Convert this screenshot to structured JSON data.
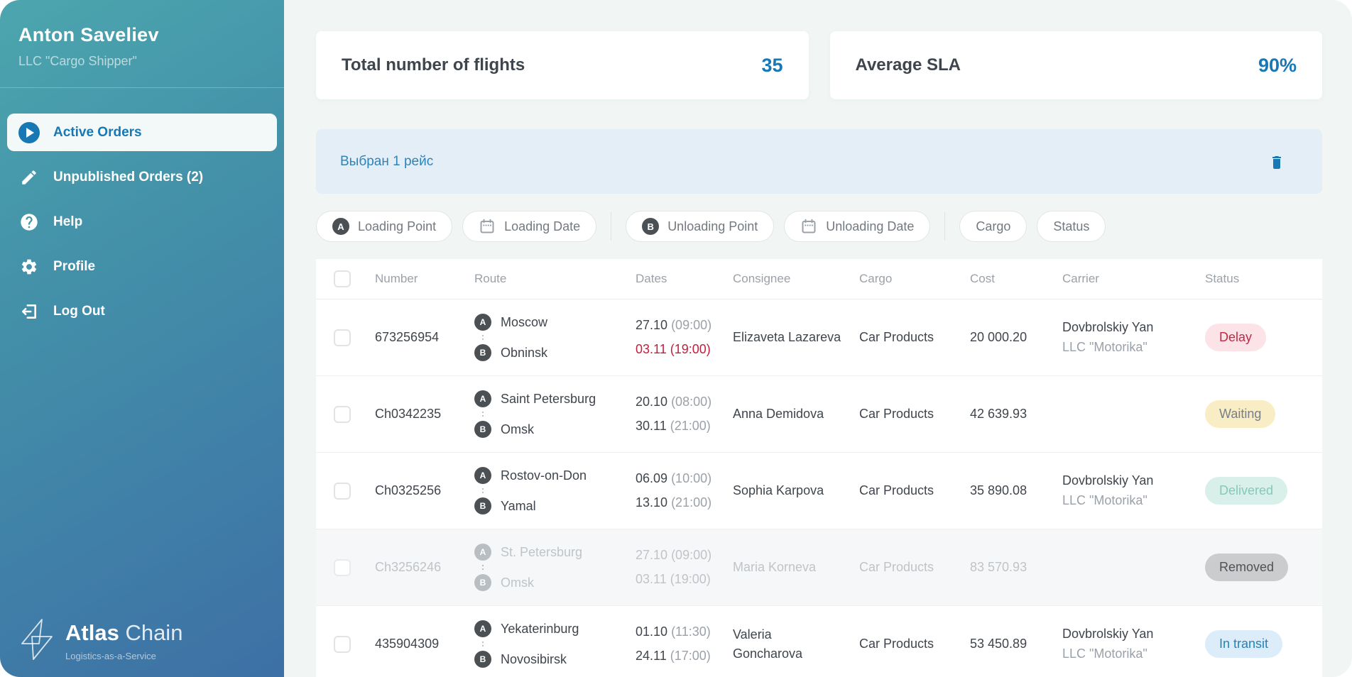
{
  "sidebar": {
    "user_name": "Anton Saveliev",
    "company": "LLC \"Cargo Shipper\"",
    "menu": [
      {
        "label": "Active Orders",
        "icon": "play-circle-icon",
        "active": true
      },
      {
        "label": "Unpublished Orders (2)",
        "icon": "pencil-icon",
        "active": false
      },
      {
        "label": "Help",
        "icon": "question-circle-icon",
        "active": false
      },
      {
        "label": "Profile",
        "icon": "gear-icon",
        "active": false
      },
      {
        "label": "Log Out",
        "icon": "logout-icon",
        "active": false
      }
    ],
    "logo": {
      "brand_strong": "Atlas",
      "brand_light": "Chain",
      "tagline": "Logistics-as-a-Service"
    }
  },
  "stats": {
    "flights_label": "Total number of flights",
    "flights_value": "35",
    "sla_label": "Average SLA",
    "sla_value": "90%"
  },
  "selection": {
    "text": "Выбран 1 рейс"
  },
  "filters": {
    "loading_point": "Loading Point",
    "loading_date": "Loading Date",
    "unloading_point": "Unloading Point",
    "unloading_date": "Unloading Date",
    "cargo": "Cargo",
    "status": "Status"
  },
  "table": {
    "route_badge_a": "A",
    "route_badge_b": "B",
    "headers": {
      "number": "Number",
      "route": "Route",
      "dates": "Dates",
      "consignee": "Consignee",
      "cargo": "Cargo",
      "cost": "Cost",
      "carrier": "Carrier",
      "status": "Status"
    },
    "rows": [
      {
        "number": "673256954",
        "from": "Moscow",
        "to": "Obninsk",
        "date1": "27.10",
        "time1": "(09:00)",
        "date2": "03.11",
        "time2": "(19:00)",
        "date2_alert": true,
        "consignee": "Elizaveta Lazareva",
        "cargo": "Car Products",
        "cost": "20 000.20",
        "carrier_name": "Dovbrolskiy Yan",
        "carrier_company": "LLC \"Motorika\"",
        "status": "Delay",
        "status_type": "delay",
        "removed": false
      },
      {
        "number": "Ch0342235",
        "from": "Saint Petersburg",
        "to": "Omsk",
        "date1": "20.10",
        "time1": "(08:00)",
        "date2": "30.11",
        "time2": "(21:00)",
        "date2_alert": false,
        "consignee": "Anna Demidova",
        "cargo": "Car Products",
        "cost": "42 639.93",
        "carrier_name": "",
        "carrier_company": "",
        "status": "Waiting",
        "status_type": "waiting",
        "removed": false
      },
      {
        "number": "Ch0325256",
        "from": "Rostov-on-Don",
        "to": "Yamal",
        "date1": "06.09",
        "time1": "(10:00)",
        "date2": "13.10",
        "time2": "(21:00)",
        "date2_alert": false,
        "consignee": "Sophia Karpova",
        "cargo": "Car Products",
        "cost": "35 890.08",
        "carrier_name": "Dovbrolskiy Yan",
        "carrier_company": "LLC \"Motorika\"",
        "status": "Delivered",
        "status_type": "delivered",
        "removed": false
      },
      {
        "number": "Ch3256246",
        "from": "St. Petersburg",
        "to": "Omsk",
        "date1": "27.10",
        "time1": "(09:00)",
        "date2": "03.11",
        "time2": "(19:00)",
        "date2_alert": false,
        "consignee": "Maria Korneva",
        "cargo": "Car Products",
        "cost": "83 570.93",
        "carrier_name": "",
        "carrier_company": "",
        "status": "Removed",
        "status_type": "removed",
        "removed": true
      },
      {
        "number": "435904309",
        "from": "Yekaterinburg",
        "to": "Novosibirsk",
        "date1": "01.10",
        "time1": "(11:30)",
        "date2": "24.11",
        "time2": "(17:00)",
        "date2_alert": false,
        "consignee": "Valeria\nGoncharova",
        "cargo": "Car Products",
        "cost": "53 450.89",
        "carrier_name": "Dovbrolskiy Yan",
        "carrier_company": "LLC \"Motorika\"",
        "status": "In transit",
        "status_type": "transit",
        "removed": false
      }
    ]
  },
  "colors": {
    "accent_blue": "#1878b3",
    "alert_red": "#c11f3e",
    "sidebar_teal": "#4ca6ae",
    "sidebar_blue": "#3d70a6",
    "selection_bg": "#e4eef7",
    "status_delay_bg": "#fbe3e8",
    "status_waiting_bg": "#f9edc6",
    "status_delivered_bg": "#d9efe9",
    "status_removed_bg": "#cbcccd",
    "status_transit_bg": "#dcecf8"
  }
}
